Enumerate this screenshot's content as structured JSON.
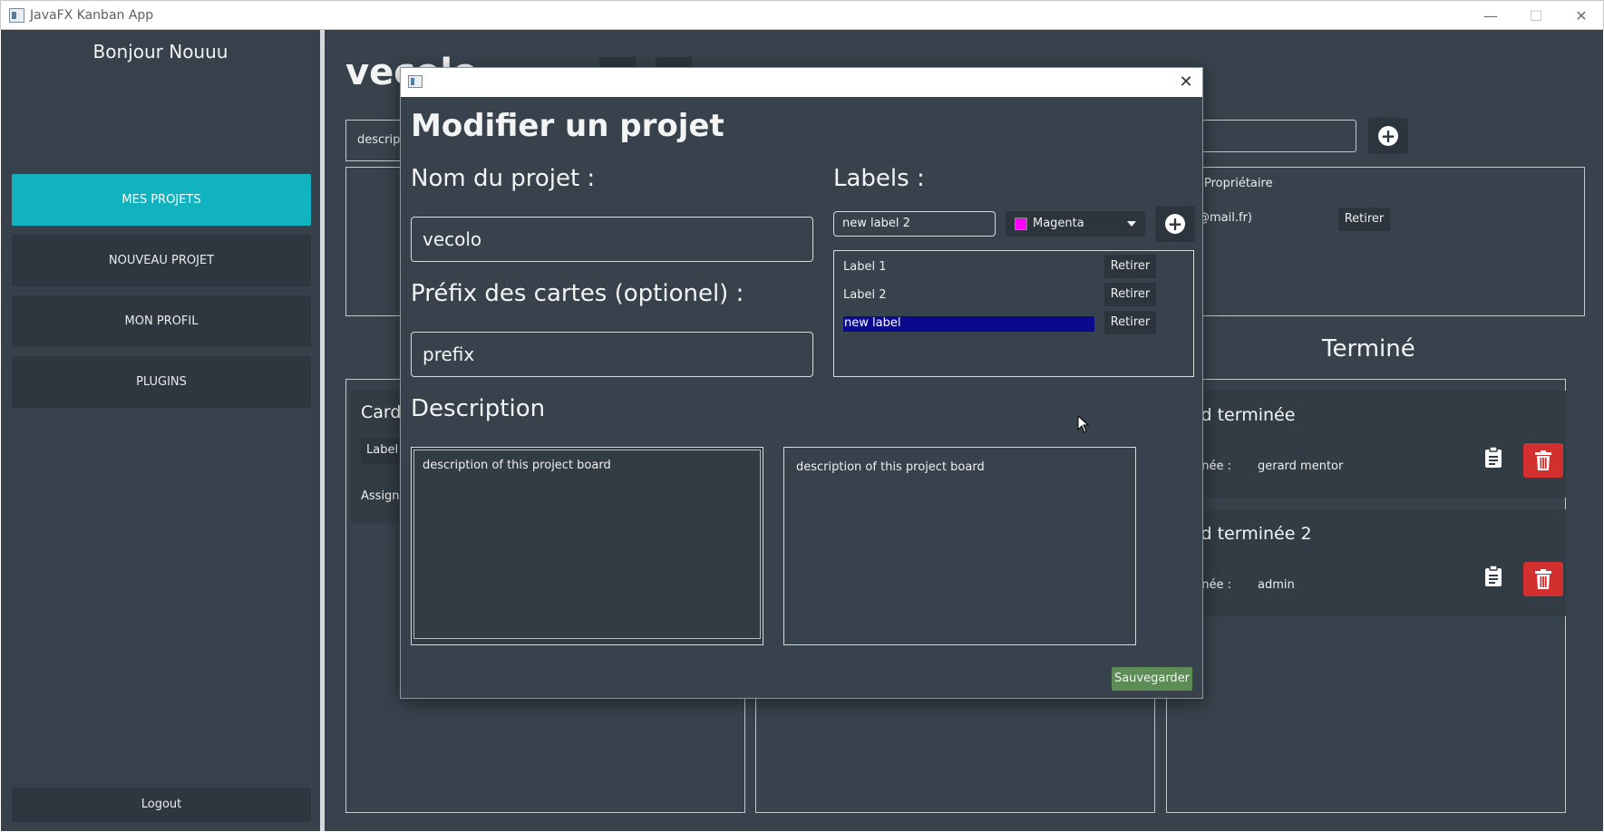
{
  "window": {
    "title": "JavaFX Kanban App",
    "minimize": "—",
    "maximize": "☐",
    "close": "✕"
  },
  "sidebar": {
    "greeting": "Bonjour Nouuu",
    "items": [
      {
        "label": "MES PROJETS",
        "active": true
      },
      {
        "label": "NOUVEAU PROJET",
        "active": false
      },
      {
        "label": "MON PROFIL",
        "active": false
      },
      {
        "label": "PLUGINS",
        "active": false
      }
    ],
    "logout": "Logout"
  },
  "board": {
    "title": "vecolo",
    "description_field": "descript",
    "owner_label": "Propriétaire",
    "owner_email": "@mail.fr)",
    "owner_remove": "Retirer",
    "left_card": {
      "title": "Card",
      "label": "Label",
      "assignee": "Assigné"
    },
    "done_column": {
      "title": "Terminé",
      "cards": [
        {
          "title": "rd terminée",
          "assigned_label": "gnée :",
          "assignee": "gerard mentor"
        },
        {
          "title": "rd terminée 2",
          "assigned_label": "gnée :",
          "assignee": "admin"
        }
      ]
    }
  },
  "modal": {
    "title": "Modifier un projet",
    "name_label": "Nom du projet :",
    "name_value": "vecolo",
    "prefix_label": "Préfix des cartes (optionel) :",
    "prefix_value": "prefix",
    "description_label": "Description",
    "description_value": "description of this project board",
    "description_preview": "description of this project board",
    "labels_label": "Labels :",
    "new_label_value": "new label 2",
    "color_value": "Magenta",
    "labels": [
      {
        "name": "Label 1",
        "remove": "Retirer",
        "selected": false
      },
      {
        "name": "Label 2",
        "remove": "Retirer",
        "selected": false
      },
      {
        "name": "new label",
        "remove": "Retirer",
        "selected": true
      }
    ],
    "save": "Sauvegarder"
  },
  "colors": {
    "accent": "#10b3bf",
    "background": "#37424c",
    "delete": "#d32f2f",
    "save": "#5e8c57",
    "selection": "#0a0a8c",
    "swatch": "#ff00ff"
  }
}
